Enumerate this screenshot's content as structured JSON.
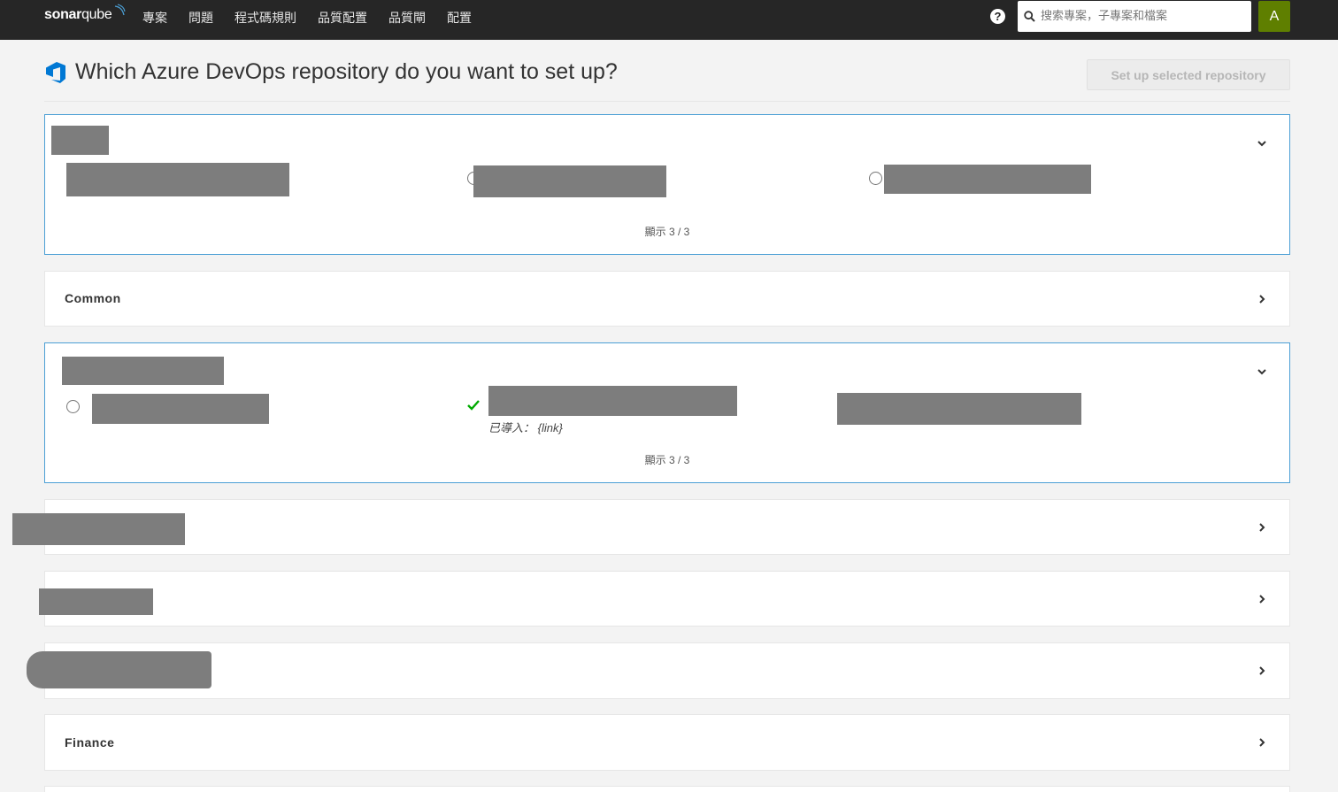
{
  "nav": {
    "brand_bold": "sonar",
    "brand_light": "qube",
    "links": [
      "專案",
      "問題",
      "程式碼規則",
      "品質配置",
      "品質閘",
      "配置"
    ],
    "search_placeholder": "搜索專案，子專案和檔案",
    "avatar_letter": "A"
  },
  "header": {
    "title": "Which Azure DevOps repository do you want to set up?",
    "setup_button": "Set up selected repository"
  },
  "groups": [
    {
      "name": "",
      "expanded": true,
      "showing": "顯示 3 / 3"
    },
    {
      "name": "Common",
      "expanded": false
    },
    {
      "name": "",
      "expanded": true,
      "showing": "顯示 3 / 3",
      "imported_label": "已導入： {link}"
    },
    {
      "name": "",
      "expanded": false
    },
    {
      "name": "",
      "expanded": false
    },
    {
      "name": "",
      "expanded": false
    },
    {
      "name": "Finance",
      "expanded": false
    }
  ],
  "icons": {
    "help": "question-icon",
    "search": "search-icon",
    "azure": "azure-devops-icon",
    "check": "check-icon",
    "chevron_down": "chevron-down-icon",
    "chevron_right": "chevron-right-icon"
  },
  "colors": {
    "nav_bg": "#262626",
    "accent_border": "#4b9fd5",
    "avatar_bg": "#5f7f00",
    "azure_blue": "#0078d4",
    "check_green": "#00aa00"
  }
}
